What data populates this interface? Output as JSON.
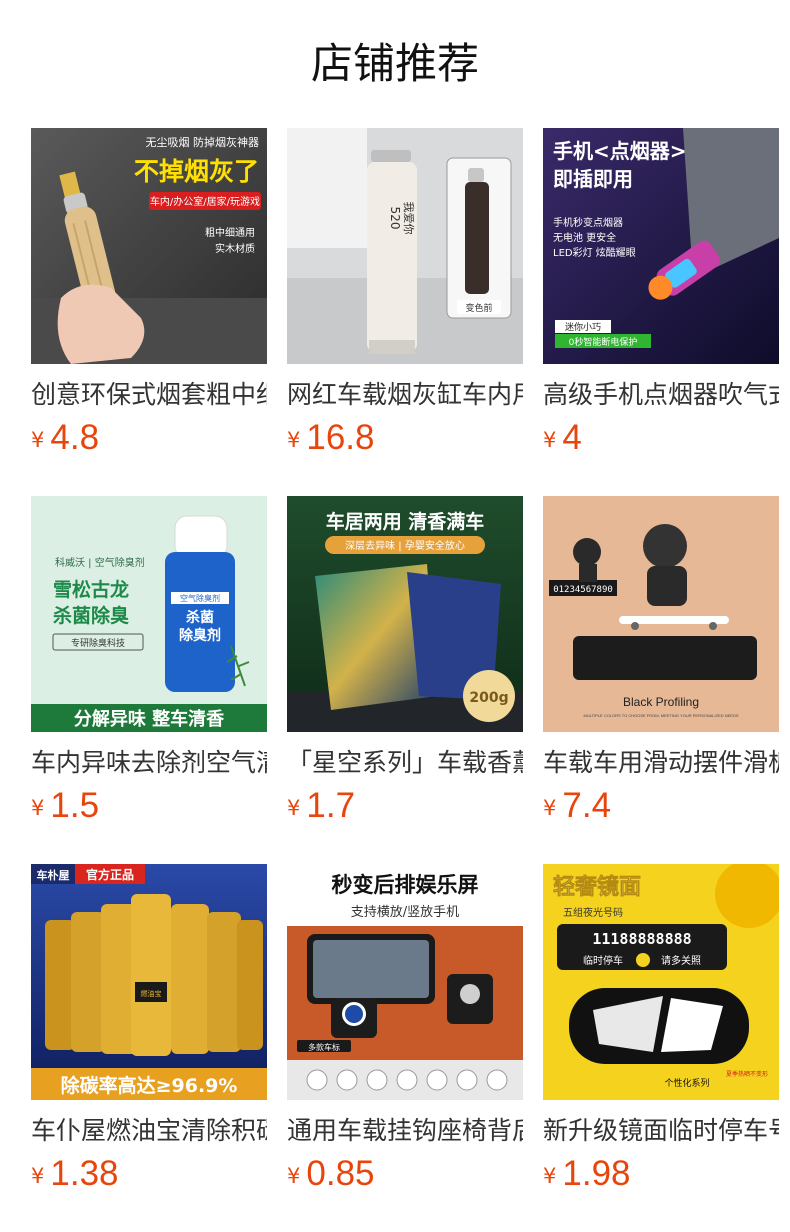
{
  "header": {
    "title": "店铺推荐"
  },
  "currency_symbol": "¥",
  "products": [
    {
      "name": "创意环保式烟套粗中细",
      "price": "4.8",
      "image": {
        "icon": "cigarette-holder-icon",
        "texts": [
          "无尘吸烟 防掉烟灰神器",
          "不掉烟灰了",
          "车内/办公室/居家/玩游戏",
          "粗中细通用",
          "实木材质"
        ]
      }
    },
    {
      "name": "网红车载烟灰缸车内用",
      "price": "16.8",
      "image": {
        "icon": "ashtray-icon",
        "texts": [
          "520",
          "我爱你",
          "变色前"
        ]
      }
    },
    {
      "name": "高级手机点烟器吹气式",
      "price": "4",
      "image": {
        "icon": "phone-lighter-icon",
        "texts": [
          "手机<点烟器>",
          "即插即用",
          "手机秒变点烟器",
          "无电池 更安全",
          "LED彩灯 炫酷耀眼",
          "迷你小巧",
          "0秒智能断电保护"
        ]
      }
    },
    {
      "name": "车内异味去除剂空气清新",
      "price": "1.5",
      "image": {
        "icon": "spray-can-icon",
        "texts": [
          "科威沃 | 空气除臭剂",
          "雪松古龙",
          "杀菌除臭",
          "专研除臭科技",
          "空气除臭剂",
          "杀菌",
          "除臭剂",
          "分解异味 整车清香"
        ]
      }
    },
    {
      "name": "「星空系列」车载香薰",
      "price": "1.7",
      "image": {
        "icon": "fragrance-bag-icon",
        "texts": [
          "车居两用 清香满车",
          "深层去异味 | 孕婴安全放心",
          "200g"
        ]
      }
    },
    {
      "name": "车载车用滑动摆件滑板",
      "price": "7.4",
      "image": {
        "icon": "skateboard-figure-icon",
        "texts": [
          "01234567890",
          "Black Profiling",
          "MULTIPLE COLORS TO CHOOSE FROM, MEETING YOUR PERSONALIZED NEEDS"
        ]
      }
    },
    {
      "name": "车仆屋燃油宝清除积碳",
      "price": "1.38",
      "image": {
        "icon": "fuel-additive-bottles-icon",
        "texts": [
          "车朴屋",
          "官方正品",
          "燃油宝",
          "除碳率高达≥96.9%"
        ]
      }
    },
    {
      "name": "通用车载挂钩座椅背后",
      "price": "0.85",
      "image": {
        "icon": "seat-hook-icon",
        "texts": [
          "秒变后排娱乐屏",
          "支持横放/竖放手机",
          "多款车标"
        ]
      }
    },
    {
      "name": "新升级镜面临时停车号码",
      "price": "1.98",
      "image": {
        "icon": "parking-number-plate-icon",
        "texts": [
          "轻奢镜面",
          "五组夜光号码",
          "11188888888",
          "临时停车",
          "请多关照",
          "个性化系列",
          "夏季热晒不变形"
        ]
      }
    }
  ]
}
